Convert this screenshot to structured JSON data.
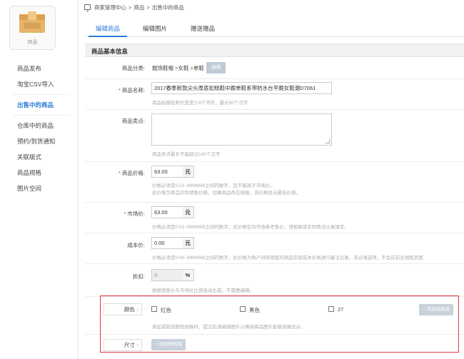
{
  "app": {
    "logo_label": "商品",
    "logo_color": "#e5b56a"
  },
  "sidebar": {
    "items": [
      {
        "label": "商品发布"
      },
      {
        "label": "淘宝CSV导入"
      },
      {
        "label": "出售中的商品",
        "active": true
      },
      {
        "label": "仓库中的商品"
      },
      {
        "label": "预约/到货通知"
      },
      {
        "label": "关联版式"
      },
      {
        "label": "商品规格"
      },
      {
        "label": "图片空间"
      }
    ]
  },
  "breadcrumb": {
    "root": "商家管理中心",
    "sep": ">",
    "level1": "商品",
    "level2": "出售中的商品"
  },
  "tabs": [
    {
      "label": "编辑商品",
      "active": true
    },
    {
      "label": "编辑图片"
    },
    {
      "label": "赠送赠品"
    }
  ],
  "section": {
    "title": "商品基本信息"
  },
  "form": {
    "category": {
      "label": "商品分类:",
      "value": "服饰鞋帽 >女鞋 >单鞋",
      "edit_label": "编辑"
    },
    "name": {
      "label": "商品名称:",
      "value": "2017春季新款尖头厚底松糕鞋中跟单鞋系带防水台平跟女鞋潮D7061",
      "hint": "商品标题名称长度至少3个字符，最长50个汉字"
    },
    "selling_point": {
      "label": "商品卖点:",
      "value": "",
      "hint": "商品卖点最长不能超过140个汉字"
    },
    "price": {
      "label": "商品价格:",
      "value": "63.00",
      "unit": "元",
      "hint1": "价格必须是0.01~9999999之间的数字，且不能高于市场价。",
      "hint2": "此价格为商品实际销售价格，如果商品存在规格，该价格显示最低价格。"
    },
    "market_price": {
      "label": "市场价:",
      "value": "63.00",
      "unit": "元",
      "hint": "价格必须是0.01~9999999之间的数字，此价格仅为市场参考售价，请根据该实际情况认真填写。"
    },
    "cost_price": {
      "label": "成本价:",
      "value": "0.00",
      "unit": "元",
      "hint": "价格必须是0.00~9999999之间的数字，此价格为商户对所销售的商品实际成本价格进行备注记录，非必填选项，不会在前台销售页面"
    },
    "discount": {
      "label": "折扣:",
      "value": "0",
      "unit": "%",
      "hint": "根据销售价与市场价比例自动生成，不需要编辑。"
    },
    "color": {
      "label": "颜色",
      "colon": ":",
      "options": [
        "红色",
        "黑色",
        "27"
      ],
      "add_label": "添加规格值",
      "hint": "添加或取消颜色规格时，提交后请编辑图片以确保商品图片能够准确显示。"
    },
    "size": {
      "label": "尺寸",
      "colon": ":",
      "add_label": "添加规格值"
    }
  },
  "colors": {
    "accent": "#2b7bd6",
    "required": "#e4393c",
    "highlight": "#e0393e"
  }
}
